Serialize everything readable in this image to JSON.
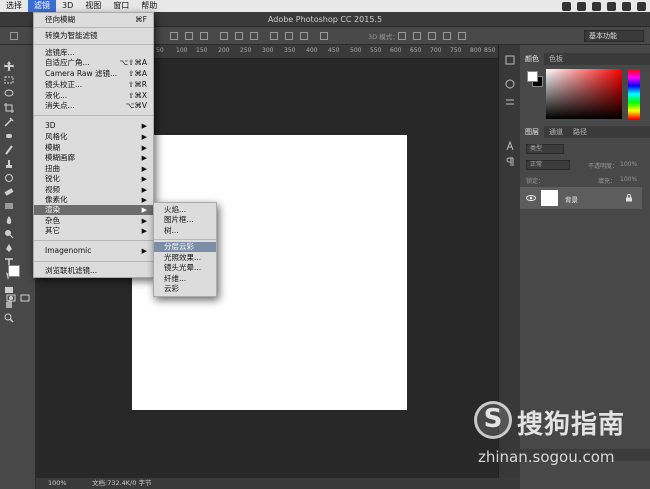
{
  "menubar": {
    "items": [
      "选择",
      "滤镜",
      "3D",
      "视图",
      "窗口",
      "帮助"
    ],
    "active_index": 1
  },
  "window": {
    "title": "Adobe Photoshop CC 2015.5"
  },
  "options_bar": {
    "workspace": "基本功能",
    "mode_3d": "3D 模式："
  },
  "ruler": {
    "ticks": [
      "50",
      "100",
      "150",
      "200",
      "250",
      "300",
      "350",
      "400",
      "450",
      "500",
      "550",
      "600",
      "650",
      "700",
      "750",
      "800",
      "850",
      "900"
    ]
  },
  "statusbar": {
    "zoom": "100%",
    "doc_info": "文档:732.4K/0 字节"
  },
  "filter_menu": {
    "items": [
      {
        "label": "径向模糊",
        "shortcut": "⌘F"
      },
      {
        "label": "转换为智能滤镜",
        "shortcut": ""
      },
      {
        "label": "滤镜库...",
        "shortcut": ""
      },
      {
        "label": "自适应广角...",
        "shortcut": "⌥⇧⌘A"
      },
      {
        "label": "Camera Raw 滤镜...",
        "shortcut": "⇧⌘A"
      },
      {
        "label": "镜头校正...",
        "shortcut": "⇧⌘R"
      },
      {
        "label": "液化...",
        "shortcut": "⇧⌘X"
      },
      {
        "label": "消失点...",
        "shortcut": "⌥⌘V"
      },
      {
        "label": "3D",
        "shortcut": "▶"
      },
      {
        "label": "风格化",
        "shortcut": "▶"
      },
      {
        "label": "模糊",
        "shortcut": "▶"
      },
      {
        "label": "模糊画廊",
        "shortcut": "▶"
      },
      {
        "label": "扭曲",
        "shortcut": "▶"
      },
      {
        "label": "锐化",
        "shortcut": "▶"
      },
      {
        "label": "视频",
        "shortcut": "▶"
      },
      {
        "label": "像素化",
        "shortcut": "▶"
      },
      {
        "label": "渲染",
        "shortcut": "▶"
      },
      {
        "label": "杂色",
        "shortcut": "▶"
      },
      {
        "label": "其它",
        "shortcut": "▶"
      },
      {
        "label": "Imagenomic",
        "shortcut": "▶"
      },
      {
        "label": "浏览联机滤镜...",
        "shortcut": ""
      }
    ],
    "highlighted": "渲染"
  },
  "render_menu": {
    "items": [
      "火焰...",
      "图片框...",
      "树...",
      "分层云彩",
      "光照效果...",
      "镜头光晕...",
      "纤维...",
      "云彩"
    ],
    "highlighted": "分层云彩"
  },
  "color_panel": {
    "tabs": [
      "颜色",
      "色板"
    ],
    "foreground": "#ffffff",
    "background": "#000000",
    "hue_color": "#ff0000"
  },
  "layers_panel": {
    "tabs": [
      "图层",
      "通道",
      "路径"
    ],
    "filter_kind": "类型",
    "blend_mode": "正常",
    "opacity_label": "不透明度：",
    "opacity_value": "100%",
    "lock_label": "锁定：",
    "fill_label": "填充：",
    "fill_value": "100%",
    "layers": [
      {
        "name": "背景",
        "visible": true,
        "locked": true
      }
    ]
  },
  "watermark": {
    "logo": "S",
    "text": "搜狗指南",
    "url": "zhinan.sogou.com"
  }
}
